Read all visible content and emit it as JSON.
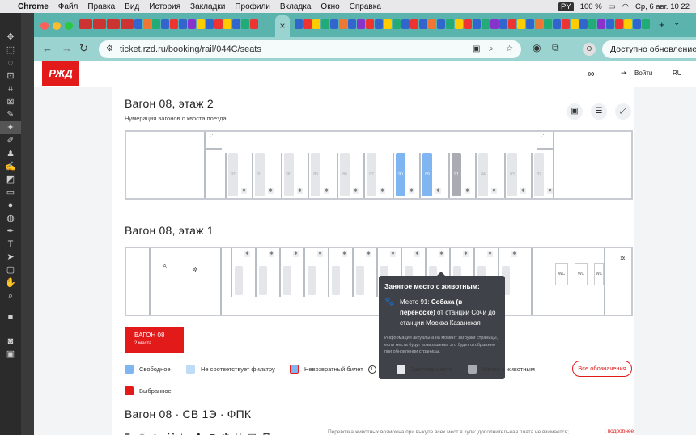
{
  "menubar": {
    "app": "Chrome",
    "items": [
      "Файл",
      "Правка",
      "Вид",
      "История",
      "Закладки",
      "Профили",
      "Вкладка",
      "Окно",
      "Справка"
    ],
    "language": "PY",
    "battery": "100 %",
    "datetime": "Ср, 6 авг.  10 22"
  },
  "browser": {
    "url": "ticket.rzd.ru/booking/rail/044C/seats",
    "profile_initial": "O",
    "update_label": "Доступно обновление Ch",
    "tab_close": "×",
    "tab_new": "+"
  },
  "site": {
    "logo": "РЖД",
    "login_label": "Войти",
    "lang": "RU"
  },
  "upper_car": {
    "title": "Вагон 08, этаж 2",
    "subtitle": "Нумерация вагонов с хвоста поезда",
    "seats": [
      {
        "num": "92",
        "state": "busy"
      },
      {
        "num": "91",
        "state": "busy"
      },
      {
        "num": "90",
        "state": "busy"
      },
      {
        "num": "89",
        "state": "busy"
      },
      {
        "num": "88",
        "state": "busy"
      },
      {
        "num": "87",
        "state": "busy"
      },
      {
        "num": "90",
        "state": "free"
      },
      {
        "num": "89",
        "state": "free"
      },
      {
        "num": "91",
        "state": "pet"
      },
      {
        "num": "84",
        "state": "busy"
      },
      {
        "num": "83",
        "state": "busy"
      },
      {
        "num": "82",
        "state": "busy"
      }
    ]
  },
  "lower_car": {
    "title": "Вагон 08, этаж 1",
    "wc": [
      "WC",
      "WC",
      "WC"
    ]
  },
  "tooltip": {
    "title": "Занятое место с животным:",
    "seat_label": "Место 91:",
    "animal": "Собака (в переноске)",
    "route": "от станции Сочи до станции Москва Казанская",
    "note": "Информация актуальна на момент загрузки страницы, если места будут возвращены, это будет отображено при обновлении страницы."
  },
  "wagon_button": {
    "name": "ВАГОН 08",
    "places": "2 места"
  },
  "legend": {
    "free": "Свободное",
    "no_filter": "Не соответствует фильтру",
    "nonrefund": "Невозвратный билет",
    "busy": "Занятое место",
    "pet": "Место с животным",
    "selected": "Выбранное",
    "all": "Все обозначения",
    "colors": {
      "free": "#7fb5f0",
      "no_filter": "#bfdcf7",
      "nonrefund": "#7fb5f0",
      "busy": "#e6e8eb",
      "pet": "#a9adb3",
      "selected": "#e21a1a"
    }
  },
  "bottom": {
    "title": "Вагон 08 · СВ 1Э · ФПК",
    "pet_text": "Перевозка животных возможна при выкупе всех мест в купе: дополнительная плата не взимается; разрешена перевозка одной Переноски* или крупной собаки (без переноски)** на одно место; на каждую Переноску или крупную собаку (без переноски) оформляется безденежный перевозочный",
    "more": "; подробнее"
  }
}
